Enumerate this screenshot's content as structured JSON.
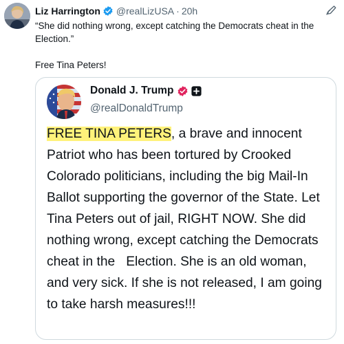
{
  "tweet": {
    "author_name": "Liz Harrington",
    "handle": "@realLizUSA",
    "separator": "·",
    "time": "20h",
    "text_line1": "“She did nothing wrong, except catching the Democrats cheat in the Election.”",
    "text_line2": "Free Tina Peters!"
  },
  "quoted": {
    "author_name": "Donald J. Trump",
    "handle": "@realDonaldTrump",
    "highlighted_text": "FREE TINA PETERS",
    "body_text": ", a brave and innocent Patriot who has been tortured by Crooked Colorado politicians, including the big Mail-In Ballot supporting the governor of the State. Let Tina Peters out of jail, RIGHT NOW. She did nothing wrong, except catching the Democrats cheat in the   Election. She is an old woman, and very sick. If she is not released, I am going to take harsh measures!!!"
  },
  "colors": {
    "verified_blue": "#1d9bf0",
    "badge_pink": "#e0245e",
    "highlight_yellow": "#fff27a",
    "secondary_text": "#536471",
    "border": "#cfd9de"
  },
  "icons": {
    "verified": "verified-badge-icon",
    "more": "more-options-icon",
    "quoted_badge": "pink-verified-badge-icon",
    "affiliate": "affiliate-plus-icon"
  }
}
